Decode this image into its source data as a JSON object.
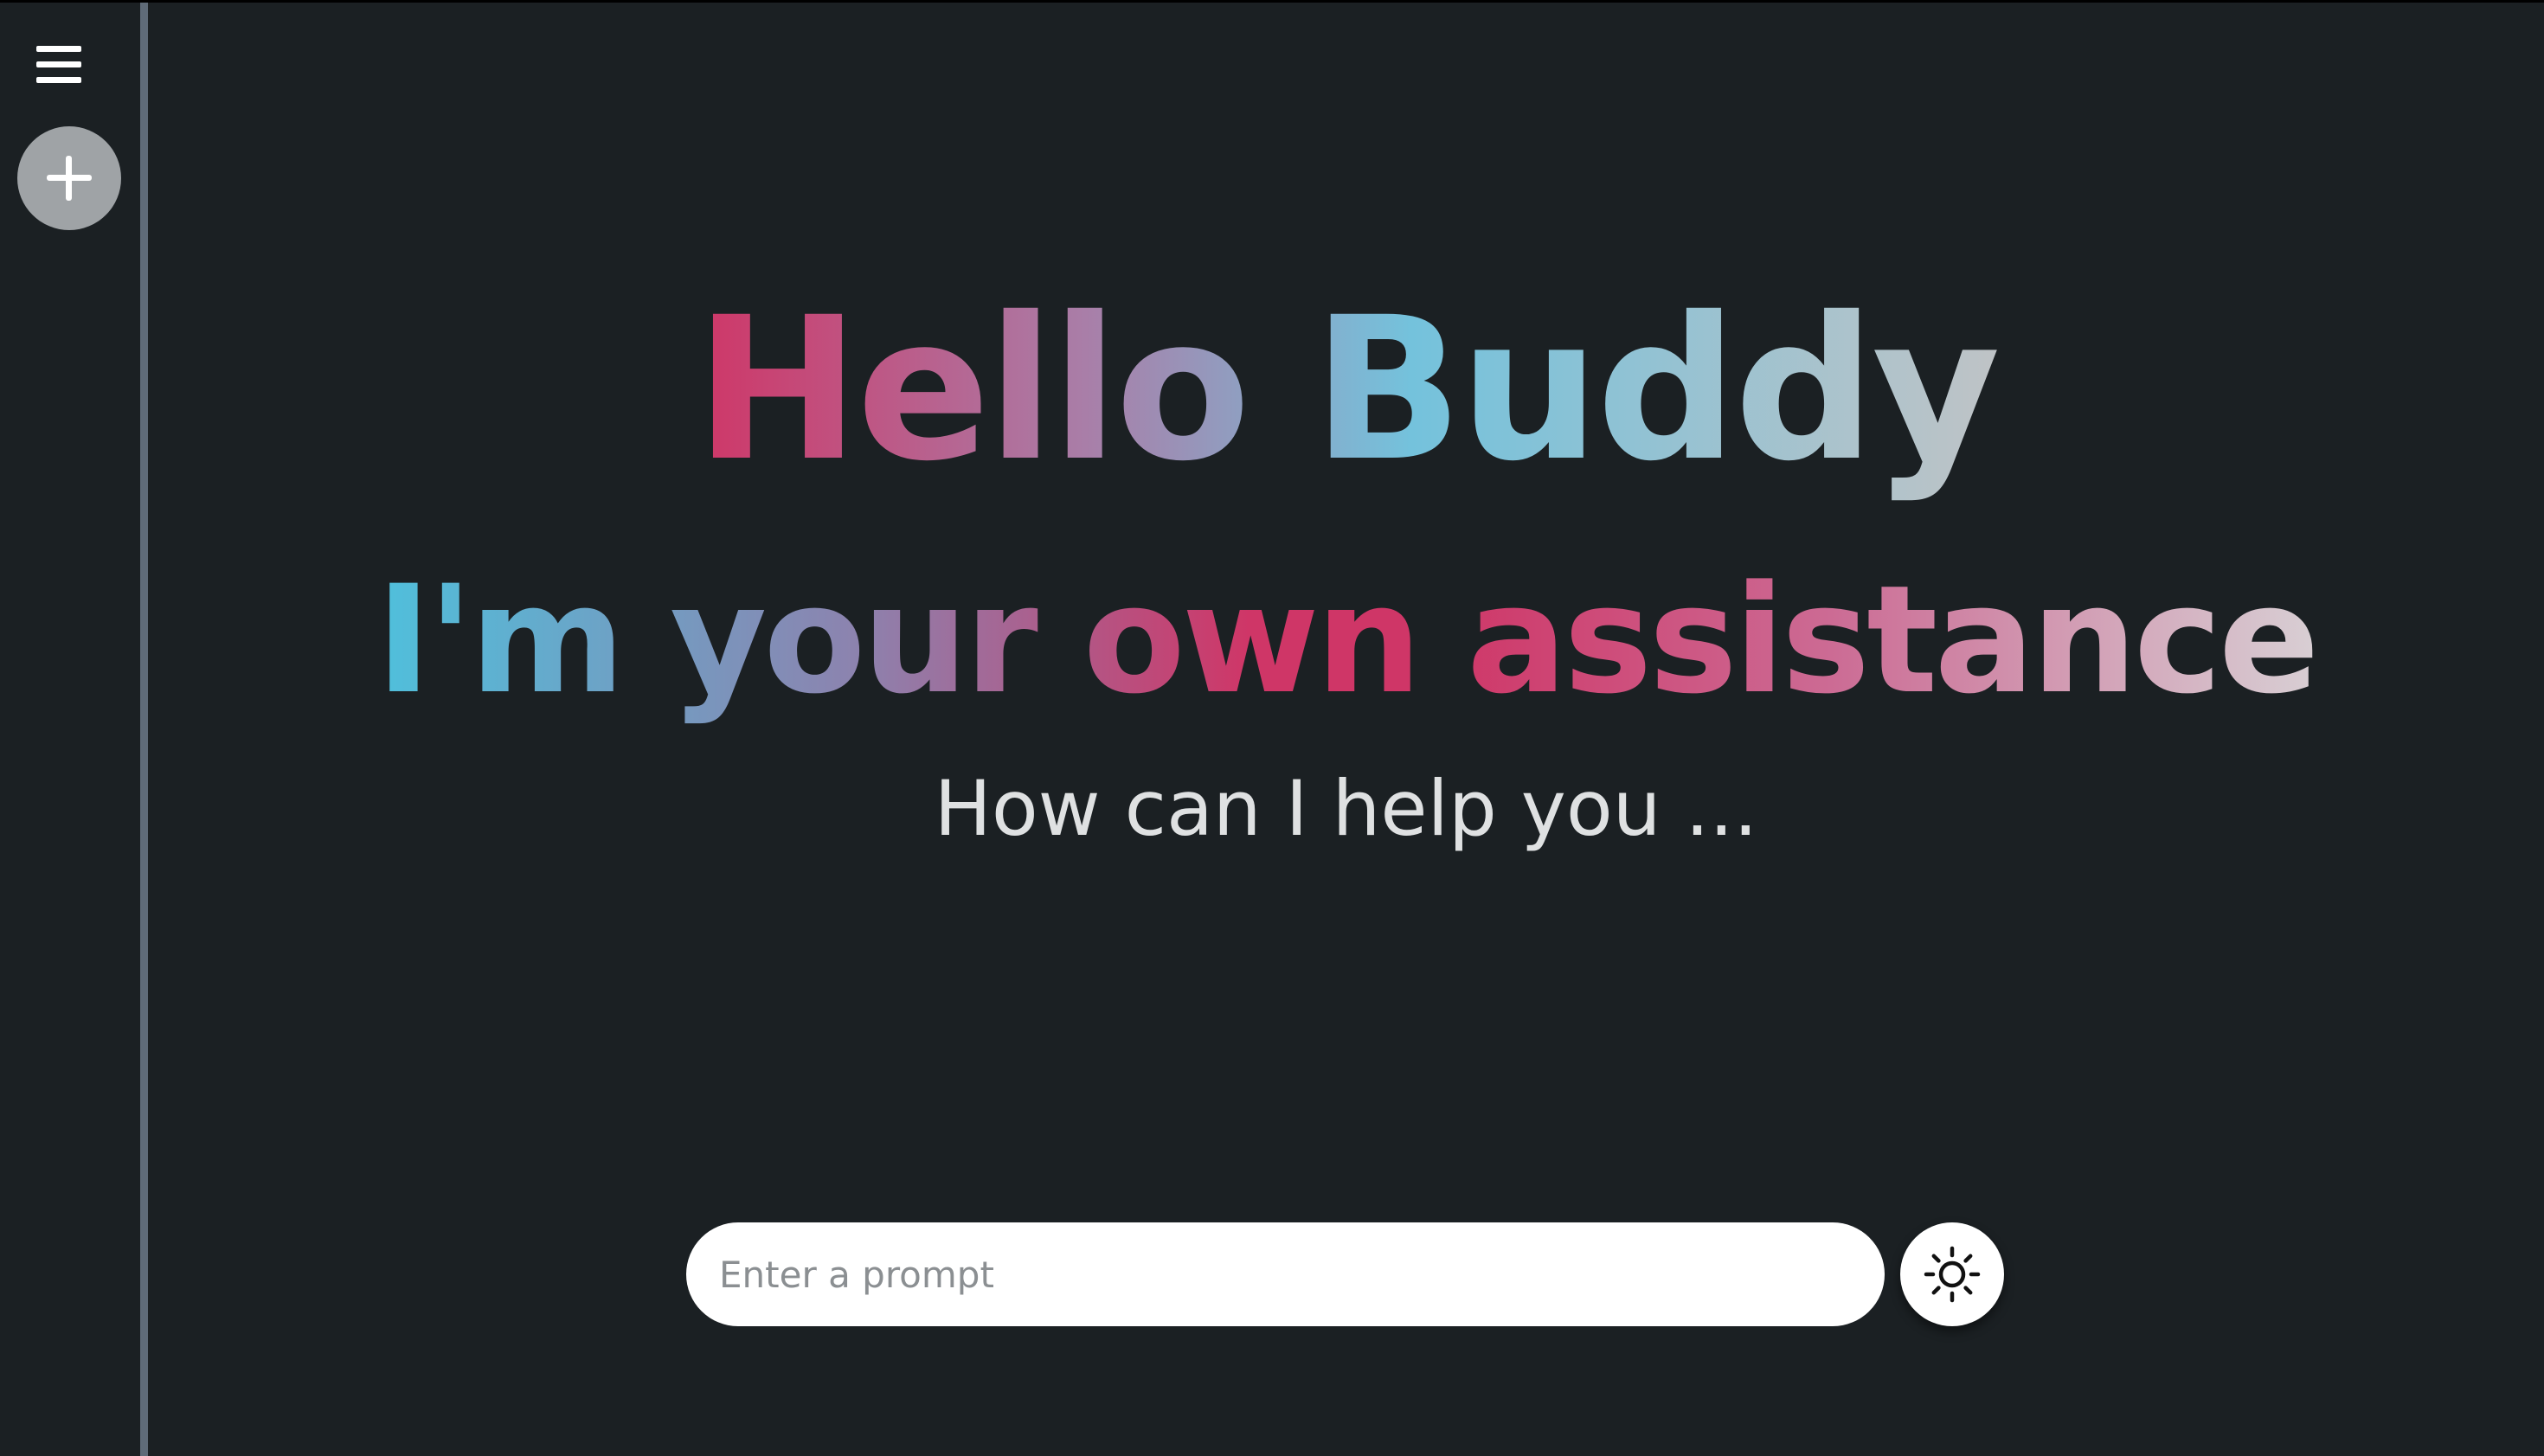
{
  "sidebar": {
    "menu_icon": "hamburger-menu-icon",
    "new_chat_icon": "plus-icon"
  },
  "main": {
    "greeting_line1": "Hello Buddy",
    "greeting_line2": "I'm your own assistance",
    "subtitle": "How can I help you ..."
  },
  "prompt": {
    "value": "",
    "placeholder": "Enter a prompt"
  },
  "theme_toggle": {
    "icon": "sun-icon"
  },
  "colors": {
    "background": "#1b2023",
    "sidebar_border": "#5f6b78",
    "accent_pink": "#cf3667",
    "accent_blue": "#74c2dc",
    "new_chat_button": "#9fa3a6"
  }
}
